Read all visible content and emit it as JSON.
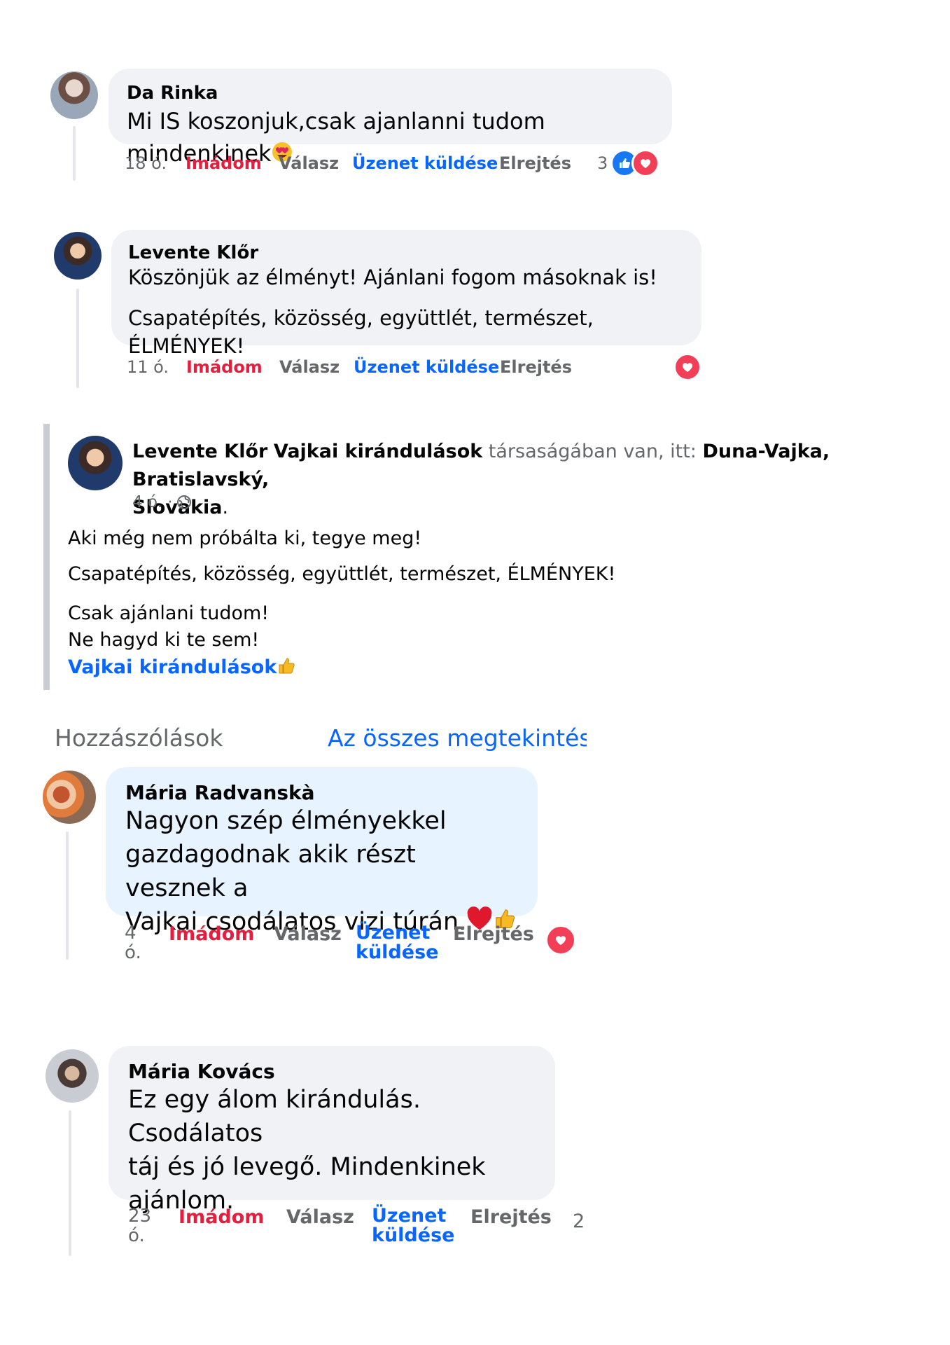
{
  "comments": [
    {
      "author": "Da Rinka",
      "text": "Mi IS koszonjuk,csak ajanlanni tudom mindenkinek",
      "time": "18 ó.",
      "react_count": "3"
    },
    {
      "author": "Levente Klőr",
      "text1": "Köszönjük az élményt! Ajánlani fogom másoknak is!",
      "text2": "Csapatépítés, közösség, együttlét, természet, ÉLMÉNYEK!",
      "time": "11 ó."
    },
    {
      "author": "Mária Radvanskà",
      "text": [
        "Nagyon szép élményekkel",
        "gazdagodnak akik részt vesznek a",
        "Vajkai csodálatos vizi túrán."
      ],
      "time": [
        "4",
        "ó."
      ]
    },
    {
      "author": "Mária Kovács",
      "text": [
        "Ez egy álom kirándulás. Csodálatos",
        "táj és jó levegő. Mindenkinek",
        "ajánlom."
      ],
      "time": [
        "23",
        "ó."
      ],
      "react_count": "2"
    }
  ],
  "actions": {
    "like": "Imádom",
    "reply": "Válasz",
    "message": "Üzenet küldése",
    "message_line1": "Üzenet",
    "message_line2": "küldése",
    "hide": "Elrejtés"
  },
  "post": {
    "author": "Levente Klőr",
    "group": "Vajkai kirándulások",
    "with_text": "társaságában van, itt:",
    "location_line1": "Duna-Vajka, Bratislavský,",
    "location_line2": "Slovakia",
    "time": "4 ó. ·",
    "lines": [
      "Aki még nem próbálta ki, tegye meg!",
      "Csapatépítés, közösség, együttlét, természet, ÉLMÉNYEK!",
      "Csak ajánlani tudom!",
      "Ne hagyd ki te sem!"
    ],
    "tag": "Vajkai kirándulások"
  },
  "section": {
    "title": "Hozzászólások",
    "see_all": "Az összes megtekintése"
  },
  "colors": {
    "like_red": "#e41e3f",
    "link_blue": "#0866ff",
    "meta_gray": "#65676b",
    "bubble_gray": "#f0f2f5",
    "bubble_blue": "#e7f3ff"
  }
}
